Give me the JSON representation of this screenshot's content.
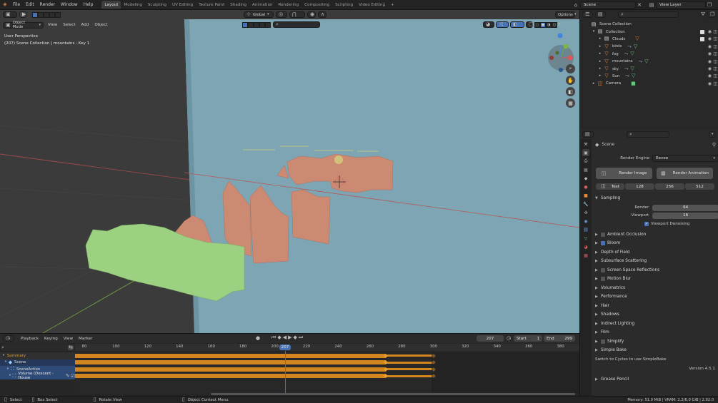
{
  "topbar": {
    "menus": [
      "File",
      "Edit",
      "Render",
      "Window",
      "Help"
    ],
    "workspaces": [
      "Layout",
      "Modeling",
      "Sculpting",
      "UV Editing",
      "Texture Paint",
      "Shading",
      "Animation",
      "Rendering",
      "Compositing",
      "Scripting",
      "Video Editing",
      "+"
    ],
    "active_workspace": "Layout",
    "scene": "Scene",
    "view_layer": "View Layer"
  },
  "viewport": {
    "mode": "Object Mode",
    "menus": [
      "View",
      "Select",
      "Add",
      "Object"
    ],
    "transform": "Global",
    "options": "Options",
    "overlay_line1": "User Perspective",
    "overlay_line2": "(207) Scene Collection | mountains : Key 1"
  },
  "outliner": {
    "items": [
      {
        "label": "Scene Collection",
        "depth": 0,
        "icon": "collection-icon"
      },
      {
        "label": "Collection",
        "depth": 1,
        "icon": "collection-icon"
      },
      {
        "label": "Clouds",
        "depth": 2,
        "icon": "collection-icon"
      },
      {
        "label": "birds",
        "depth": 2,
        "icon": "mesh-icon"
      },
      {
        "label": "fog",
        "depth": 2,
        "icon": "mesh-icon"
      },
      {
        "label": "mountains",
        "depth": 2,
        "icon": "mesh-icon"
      },
      {
        "label": "sky",
        "depth": 2,
        "icon": "mesh-icon"
      },
      {
        "label": "Sun",
        "depth": 2,
        "icon": "mesh-icon"
      },
      {
        "label": "Camera",
        "depth": 1,
        "icon": "camera-icon"
      }
    ]
  },
  "properties": {
    "context": "Scene",
    "render_engine_label": "Render Engine",
    "render_engine": "Eevee",
    "render_image": "Render Image",
    "render_animation": "Render Animation",
    "test_label": "Test",
    "test_sizes": [
      "128",
      "256",
      "512"
    ],
    "sampling": "Sampling",
    "render_label": "Render",
    "render_samples": "64",
    "viewport_label": "Viewport",
    "viewport_samples": "16",
    "viewport_denoising": "Viewport Denoising",
    "sections": [
      {
        "label": "Ambient Occlusion",
        "checkbox": true,
        "checked": false
      },
      {
        "label": "Bloom",
        "checkbox": true,
        "checked": true
      },
      {
        "label": "Depth of Field",
        "checkbox": false
      },
      {
        "label": "Subsurface Scattering",
        "checkbox": false
      },
      {
        "label": "Screen Space Reflections",
        "checkbox": true,
        "checked": false
      },
      {
        "label": "Motion Blur",
        "checkbox": true,
        "checked": false
      },
      {
        "label": "Volumetrics",
        "checkbox": false
      },
      {
        "label": "Performance",
        "checkbox": false
      },
      {
        "label": "Hair",
        "checkbox": false
      },
      {
        "label": "Shadows",
        "checkbox": false
      },
      {
        "label": "Indirect Lighting",
        "checkbox": false
      },
      {
        "label": "Film",
        "checkbox": false
      },
      {
        "label": "Simplify",
        "checkbox": true,
        "checked": false
      },
      {
        "label": "Simple Bake",
        "checkbox": false
      }
    ],
    "bake_note": "Switch to Cycles to use SimpleBake",
    "version": "Version 4.5.1",
    "grease_pencil": "Grease Pencil"
  },
  "timeline": {
    "menus": [
      "Playback",
      "Keying",
      "View",
      "Marker"
    ],
    "current_frame": "207",
    "start_label": "Start",
    "start": "1",
    "end_label": "End",
    "end": "299",
    "ticks": [
      "80",
      "100",
      "120",
      "140",
      "160",
      "180",
      "200",
      "220",
      "240",
      "260",
      "280",
      "300",
      "320",
      "340",
      "360",
      "380"
    ],
    "channels": [
      "Summary",
      "Scene",
      "SceneAction",
      "Volume (Descent - House"
    ]
  },
  "statusbar": {
    "select": "Select",
    "box_select": "Box Select",
    "rotate_view": "Rotate View",
    "context_menu": "Object Context Menu",
    "memory": "Memory: 51.0 MiB | VRAM: 2.2/6.0 GiB | 2.92.0"
  },
  "colors": {
    "accent": "#4772b3",
    "keyframe_bar": "#d4861e",
    "sky": "#7fa6b5",
    "mountains": "#cf8a73",
    "fog": "#9bcf80"
  }
}
